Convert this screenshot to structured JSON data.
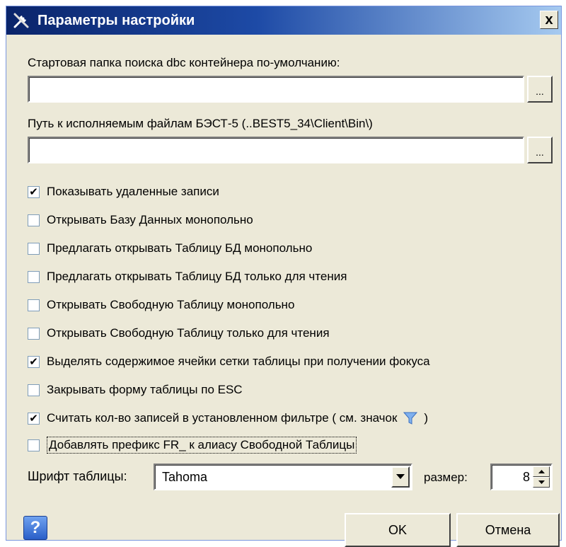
{
  "window": {
    "title": "Параметры настройки",
    "close_label": "x"
  },
  "fields": {
    "dbc_start_folder": {
      "label": "Стартовая папка поиска dbc контейнера по-умолчанию:",
      "value": "",
      "browse_label": "..."
    },
    "best5_path": {
      "label": "Путь к исполняемым файлам БЭСТ-5  (..BEST5_34\\Client\\Bin\\)",
      "value": "",
      "browse_label": "..."
    }
  },
  "checkboxes": [
    {
      "label": "Показывать удаленные записи",
      "checked": true
    },
    {
      "label": "Открывать Базу Данных монопольно",
      "checked": false
    },
    {
      "label": "Предлагать открывать Таблицу БД монопольно",
      "checked": false
    },
    {
      "label": "Предлагать открывать Таблицу БД только для чтения",
      "checked": false
    },
    {
      "label": "Открывать Свободную Таблицу монопольно",
      "checked": false
    },
    {
      "label": "Открывать Свободную Таблицу только для чтения",
      "checked": false
    },
    {
      "label": "Выделять содержимое ячейки сетки таблицы при получении фокуса",
      "checked": true
    },
    {
      "label": "Закрывать форму таблицы по ESC",
      "checked": false
    },
    {
      "label": "Считать кол-во записей в установленном фильтре  ( см. значок",
      "label_end": ")",
      "checked": true
    },
    {
      "label": "Добавлять префикс  FR_  к алиасу Свободной Таблицы",
      "checked": false
    }
  ],
  "font": {
    "label": "Шрифт таблицы:",
    "selected": "Tahoma",
    "size_label": "размер:",
    "size_value": "8"
  },
  "buttons": {
    "help": "?",
    "ok": "OK",
    "cancel": "Отмена"
  },
  "check_mark": "✔",
  "colors": {
    "title_gradient_start": "#0a246a",
    "title_gradient_end": "#a6caf0",
    "dialog_bg": "#ece9d8",
    "filter_icon": "#7fb0ee"
  }
}
